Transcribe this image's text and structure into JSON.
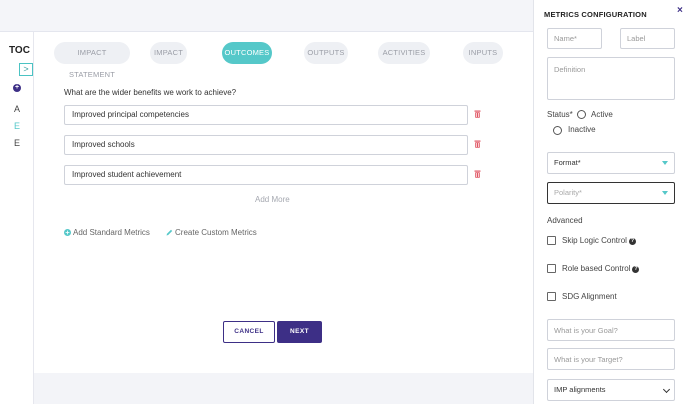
{
  "toc": {
    "title": "TOC",
    "expand_glyph": ">",
    "add_glyph": "+",
    "letters": [
      "A",
      "E",
      "E"
    ],
    "letter_colors": [
      "#444444",
      "#55c8c9",
      "#444444"
    ]
  },
  "tabs": [
    "IMPACT STATEMENT",
    "IMPACT",
    "OUTCOMES",
    "OUTPUTS",
    "ACTIVITIES",
    "INPUTS"
  ],
  "active_tab": "OUTCOMES",
  "question": "What are the wider benefits we work to achieve?",
  "outcomes": [
    "Improved principal competencies",
    "Improved schools",
    "Improved student achievement"
  ],
  "add_more": "Add More",
  "links": {
    "standard": "Add Standard Metrics",
    "custom": "Create Custom Metrics"
  },
  "buttons": {
    "cancel": "CANCEL",
    "next": "NEXT"
  },
  "panel": {
    "title": "METRICS CONFIGURATION",
    "close": "×",
    "name_placeholder": "Name*",
    "label_placeholder": "Label",
    "definition_placeholder": "Definition",
    "status_label": "Status*",
    "status_options": [
      "Active",
      "Inactive"
    ],
    "format": "Format*",
    "polarity": "Polarity*",
    "advanced": "Advanced",
    "skip_logic": "Skip Logic Control",
    "role_based": "Role based Control",
    "sdg": "SDG Alignment",
    "help_glyph": "?",
    "goal_placeholder": "What is your Goal?",
    "target_placeholder": "What is your Target?",
    "imp": "IMP alignments"
  },
  "colors": {
    "accent": "#55c8c9",
    "brand": "#3d2f86",
    "danger": "#e05563"
  }
}
